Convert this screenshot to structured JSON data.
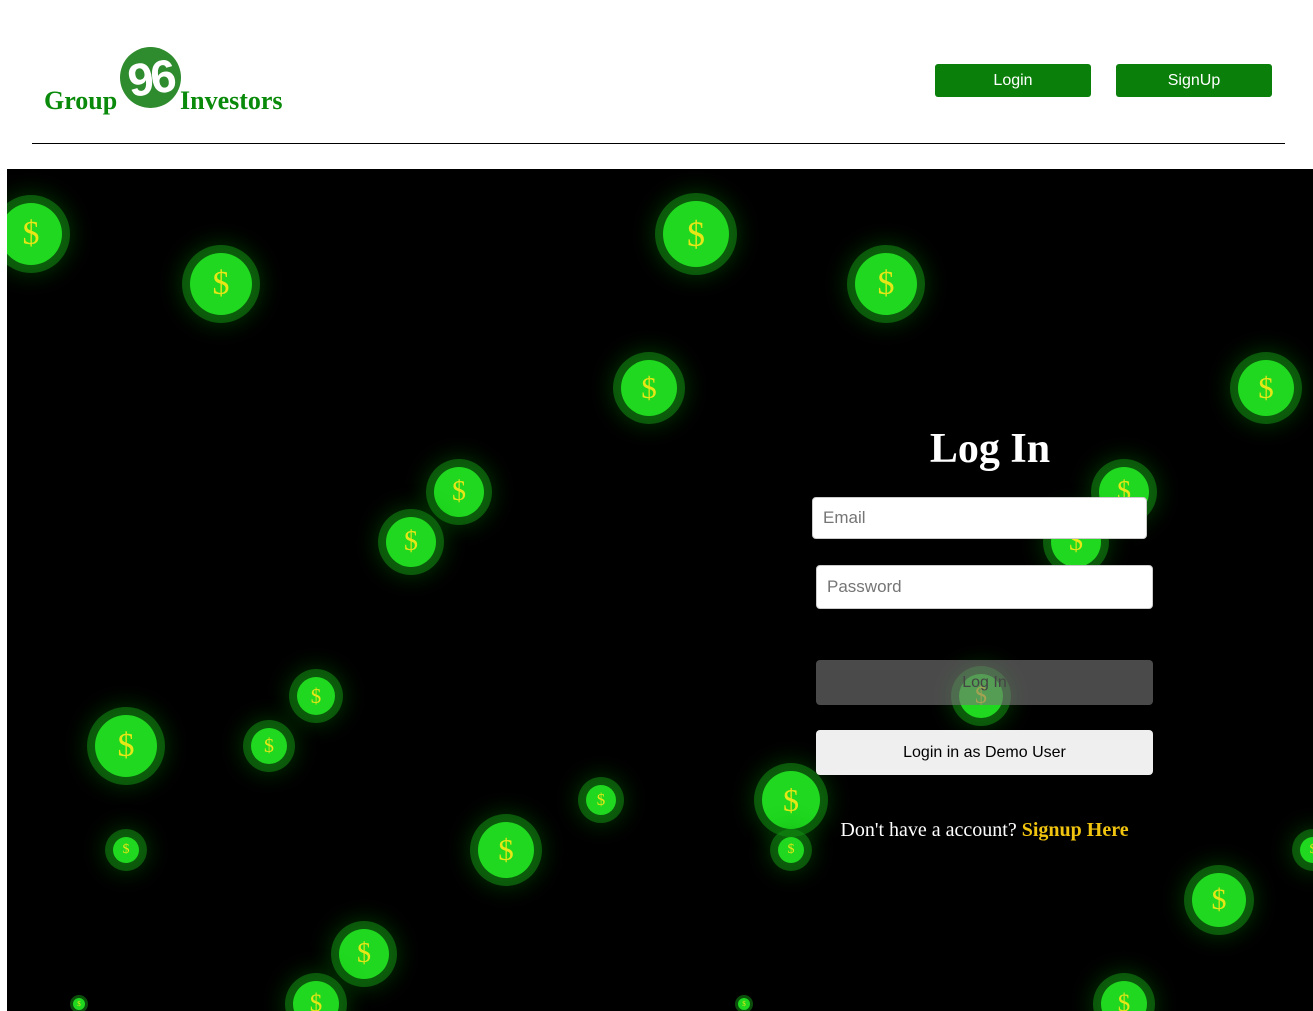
{
  "header": {
    "logo_left": "Group",
    "logo_badge": "96",
    "logo_right": "Investors",
    "login_button": "Login",
    "signup_button": "SignUp"
  },
  "background": {
    "coin_symbol": "$",
    "coin_color": "#1fd81f",
    "symbol_color": "#e7e617"
  },
  "login_form": {
    "title": "Log In",
    "email_placeholder": "Email",
    "password_placeholder": "Password",
    "submit_label": "Log In",
    "demo_label": "Login in as Demo User",
    "signup_prompt": "Don't have a account?",
    "signup_link": "Signup Here"
  },
  "colors": {
    "brand_green": "#0a7f0a",
    "link_yellow": "#f1c40f"
  }
}
